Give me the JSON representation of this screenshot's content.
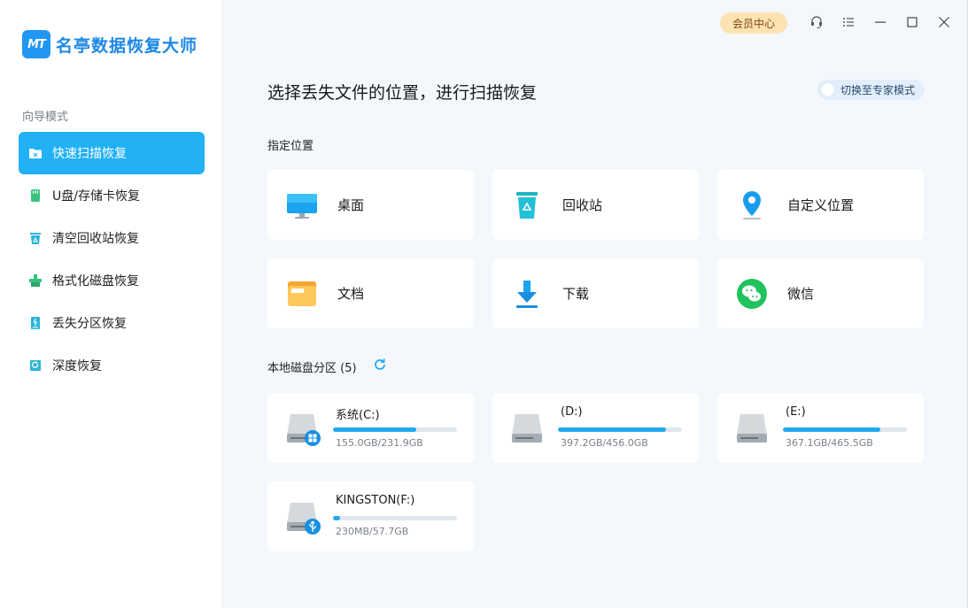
{
  "app": {
    "logo_text": "MT",
    "name": "名亭数据恢复大师"
  },
  "sidebar": {
    "section_label": "向导模式",
    "items": [
      {
        "label": "快速扫描恢复",
        "icon": "quick-scan-folder-icon",
        "active": true
      },
      {
        "label": "U盘/存储卡恢复",
        "icon": "usb-card-icon",
        "active": false
      },
      {
        "label": "清空回收站恢复",
        "icon": "recycle-bin-icon",
        "active": false
      },
      {
        "label": "格式化磁盘恢复",
        "icon": "format-disk-icon",
        "active": false
      },
      {
        "label": "丢失分区恢复",
        "icon": "lost-partition-icon",
        "active": false
      },
      {
        "label": "深度恢复",
        "icon": "deep-recovery-icon",
        "active": false
      }
    ]
  },
  "titlebar": {
    "vip_label": "会员中心",
    "icons": [
      "headset-icon",
      "menu-icon",
      "minimize-icon",
      "maximize-icon",
      "close-icon"
    ]
  },
  "main": {
    "title": "选择丢失文件的位置，进行扫描恢复",
    "mode_toggle_label": "切换至专家模式",
    "locations_label": "指定位置",
    "locations": [
      {
        "label": "桌面",
        "icon": "desktop-monitor-icon"
      },
      {
        "label": "回收站",
        "icon": "recycle-bin-icon"
      },
      {
        "label": "自定义位置",
        "icon": "location-pin-icon"
      },
      {
        "label": "文档",
        "icon": "documents-folder-icon"
      },
      {
        "label": "下载",
        "icon": "download-arrow-icon"
      },
      {
        "label": "微信",
        "icon": "wechat-icon"
      }
    ],
    "disks_label": "本地磁盘分区 (5)",
    "disks": [
      {
        "name": "系统(C:)",
        "size": "155.0GB/231.9GB",
        "used_fraction": 0.668,
        "badge": "windows-icon"
      },
      {
        "name": "(D:)",
        "size": "397.2GB/456.0GB",
        "used_fraction": 0.871,
        "badge": null
      },
      {
        "name": "(E:)",
        "size": "367.1GB/465.5GB",
        "used_fraction": 0.789,
        "badge": null
      },
      {
        "name": "KINGSTON(F:)",
        "size": "230MB/57.7GB",
        "used_fraction": 0.06,
        "badge": "usb-icon"
      }
    ]
  },
  "colors": {
    "accent": "#22b1f5",
    "brand": "#1e88e5",
    "vip_bg": "#fde2b2",
    "main_bg": "#f4f8fc"
  }
}
